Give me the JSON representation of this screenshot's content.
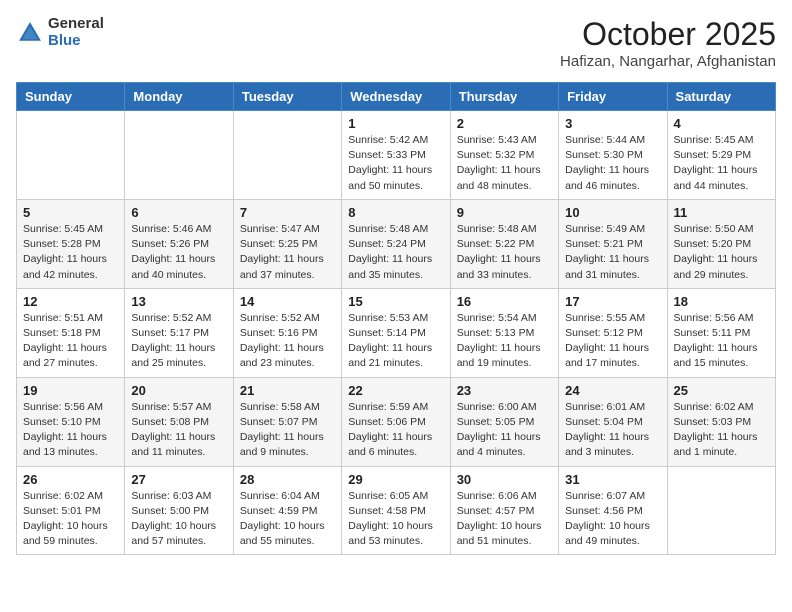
{
  "header": {
    "logo_general": "General",
    "logo_blue": "Blue",
    "month": "October 2025",
    "location": "Hafizan, Nangarhar, Afghanistan"
  },
  "weekdays": [
    "Sunday",
    "Monday",
    "Tuesday",
    "Wednesday",
    "Thursday",
    "Friday",
    "Saturday"
  ],
  "weeks": [
    [
      {
        "day": "",
        "info": ""
      },
      {
        "day": "",
        "info": ""
      },
      {
        "day": "",
        "info": ""
      },
      {
        "day": "1",
        "info": "Sunrise: 5:42 AM\nSunset: 5:33 PM\nDaylight: 11 hours\nand 50 minutes."
      },
      {
        "day": "2",
        "info": "Sunrise: 5:43 AM\nSunset: 5:32 PM\nDaylight: 11 hours\nand 48 minutes."
      },
      {
        "day": "3",
        "info": "Sunrise: 5:44 AM\nSunset: 5:30 PM\nDaylight: 11 hours\nand 46 minutes."
      },
      {
        "day": "4",
        "info": "Sunrise: 5:45 AM\nSunset: 5:29 PM\nDaylight: 11 hours\nand 44 minutes."
      }
    ],
    [
      {
        "day": "5",
        "info": "Sunrise: 5:45 AM\nSunset: 5:28 PM\nDaylight: 11 hours\nand 42 minutes."
      },
      {
        "day": "6",
        "info": "Sunrise: 5:46 AM\nSunset: 5:26 PM\nDaylight: 11 hours\nand 40 minutes."
      },
      {
        "day": "7",
        "info": "Sunrise: 5:47 AM\nSunset: 5:25 PM\nDaylight: 11 hours\nand 37 minutes."
      },
      {
        "day": "8",
        "info": "Sunrise: 5:48 AM\nSunset: 5:24 PM\nDaylight: 11 hours\nand 35 minutes."
      },
      {
        "day": "9",
        "info": "Sunrise: 5:48 AM\nSunset: 5:22 PM\nDaylight: 11 hours\nand 33 minutes."
      },
      {
        "day": "10",
        "info": "Sunrise: 5:49 AM\nSunset: 5:21 PM\nDaylight: 11 hours\nand 31 minutes."
      },
      {
        "day": "11",
        "info": "Sunrise: 5:50 AM\nSunset: 5:20 PM\nDaylight: 11 hours\nand 29 minutes."
      }
    ],
    [
      {
        "day": "12",
        "info": "Sunrise: 5:51 AM\nSunset: 5:18 PM\nDaylight: 11 hours\nand 27 minutes."
      },
      {
        "day": "13",
        "info": "Sunrise: 5:52 AM\nSunset: 5:17 PM\nDaylight: 11 hours\nand 25 minutes."
      },
      {
        "day": "14",
        "info": "Sunrise: 5:52 AM\nSunset: 5:16 PM\nDaylight: 11 hours\nand 23 minutes."
      },
      {
        "day": "15",
        "info": "Sunrise: 5:53 AM\nSunset: 5:14 PM\nDaylight: 11 hours\nand 21 minutes."
      },
      {
        "day": "16",
        "info": "Sunrise: 5:54 AM\nSunset: 5:13 PM\nDaylight: 11 hours\nand 19 minutes."
      },
      {
        "day": "17",
        "info": "Sunrise: 5:55 AM\nSunset: 5:12 PM\nDaylight: 11 hours\nand 17 minutes."
      },
      {
        "day": "18",
        "info": "Sunrise: 5:56 AM\nSunset: 5:11 PM\nDaylight: 11 hours\nand 15 minutes."
      }
    ],
    [
      {
        "day": "19",
        "info": "Sunrise: 5:56 AM\nSunset: 5:10 PM\nDaylight: 11 hours\nand 13 minutes."
      },
      {
        "day": "20",
        "info": "Sunrise: 5:57 AM\nSunset: 5:08 PM\nDaylight: 11 hours\nand 11 minutes."
      },
      {
        "day": "21",
        "info": "Sunrise: 5:58 AM\nSunset: 5:07 PM\nDaylight: 11 hours\nand 9 minutes."
      },
      {
        "day": "22",
        "info": "Sunrise: 5:59 AM\nSunset: 5:06 PM\nDaylight: 11 hours\nand 6 minutes."
      },
      {
        "day": "23",
        "info": "Sunrise: 6:00 AM\nSunset: 5:05 PM\nDaylight: 11 hours\nand 4 minutes."
      },
      {
        "day": "24",
        "info": "Sunrise: 6:01 AM\nSunset: 5:04 PM\nDaylight: 11 hours\nand 3 minutes."
      },
      {
        "day": "25",
        "info": "Sunrise: 6:02 AM\nSunset: 5:03 PM\nDaylight: 11 hours\nand 1 minute."
      }
    ],
    [
      {
        "day": "26",
        "info": "Sunrise: 6:02 AM\nSunset: 5:01 PM\nDaylight: 10 hours\nand 59 minutes."
      },
      {
        "day": "27",
        "info": "Sunrise: 6:03 AM\nSunset: 5:00 PM\nDaylight: 10 hours\nand 57 minutes."
      },
      {
        "day": "28",
        "info": "Sunrise: 6:04 AM\nSunset: 4:59 PM\nDaylight: 10 hours\nand 55 minutes."
      },
      {
        "day": "29",
        "info": "Sunrise: 6:05 AM\nSunset: 4:58 PM\nDaylight: 10 hours\nand 53 minutes."
      },
      {
        "day": "30",
        "info": "Sunrise: 6:06 AM\nSunset: 4:57 PM\nDaylight: 10 hours\nand 51 minutes."
      },
      {
        "day": "31",
        "info": "Sunrise: 6:07 AM\nSunset: 4:56 PM\nDaylight: 10 hours\nand 49 minutes."
      },
      {
        "day": "",
        "info": ""
      }
    ]
  ]
}
